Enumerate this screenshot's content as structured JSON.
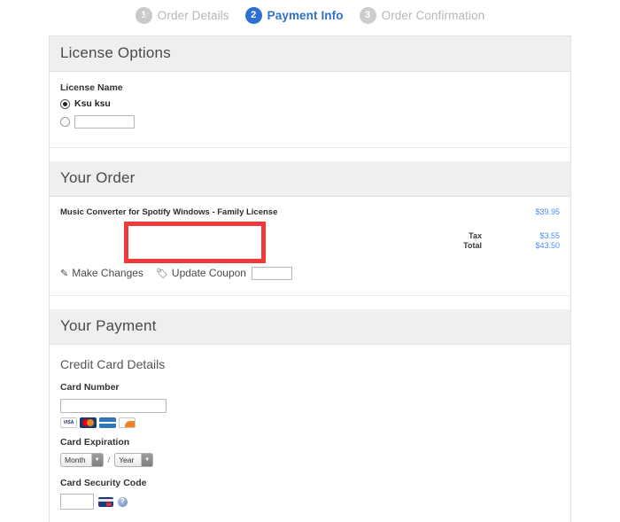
{
  "steps": [
    {
      "number": "1",
      "label": "Order Details",
      "state": "done",
      "icon": "check-icon"
    },
    {
      "number": "2",
      "label": "Payment Info",
      "state": "active"
    },
    {
      "number": "3",
      "label": "Order Confirmation",
      "state": "todo"
    }
  ],
  "license": {
    "heading": "License Options",
    "field_label": "License Name",
    "option_selected": "Ksu ksu",
    "custom_name_value": "",
    "custom_name_placeholder": ""
  },
  "order": {
    "heading": "Your Order",
    "item_name": "Music Converter for Spotify Windows - Family License",
    "item_price": "$39.95",
    "totals": [
      {
        "label": "Tax",
        "value": "$3.55"
      },
      {
        "label": "Total",
        "value": "$43.50"
      }
    ],
    "make_changes_label": "Make Changes",
    "make_changes_icon": "pencil-icon",
    "update_coupon_label": "Update Coupon",
    "update_coupon_icon": "tag-icon",
    "coupon_value": "",
    "annotation_color": "#ee3a3a"
  },
  "payment": {
    "heading": "Your Payment",
    "sub_heading": "Credit Card Details",
    "card_number_label": "Card Number",
    "card_number_value": "",
    "accepted_cards": [
      "VISA",
      "MasterCard",
      "American Express",
      "Discover"
    ],
    "expiration_label": "Card Expiration",
    "month_select": "Month",
    "year_select": "Year",
    "separator": "/",
    "security_code_label": "Card Security Code",
    "security_code_value": "",
    "help_icon_label": "?"
  },
  "colors": {
    "accent_blue": "#2f6fd0",
    "price_blue": "#4b8df8",
    "header_gray": "#efefef",
    "annotation_red": "#ee3a3a"
  }
}
